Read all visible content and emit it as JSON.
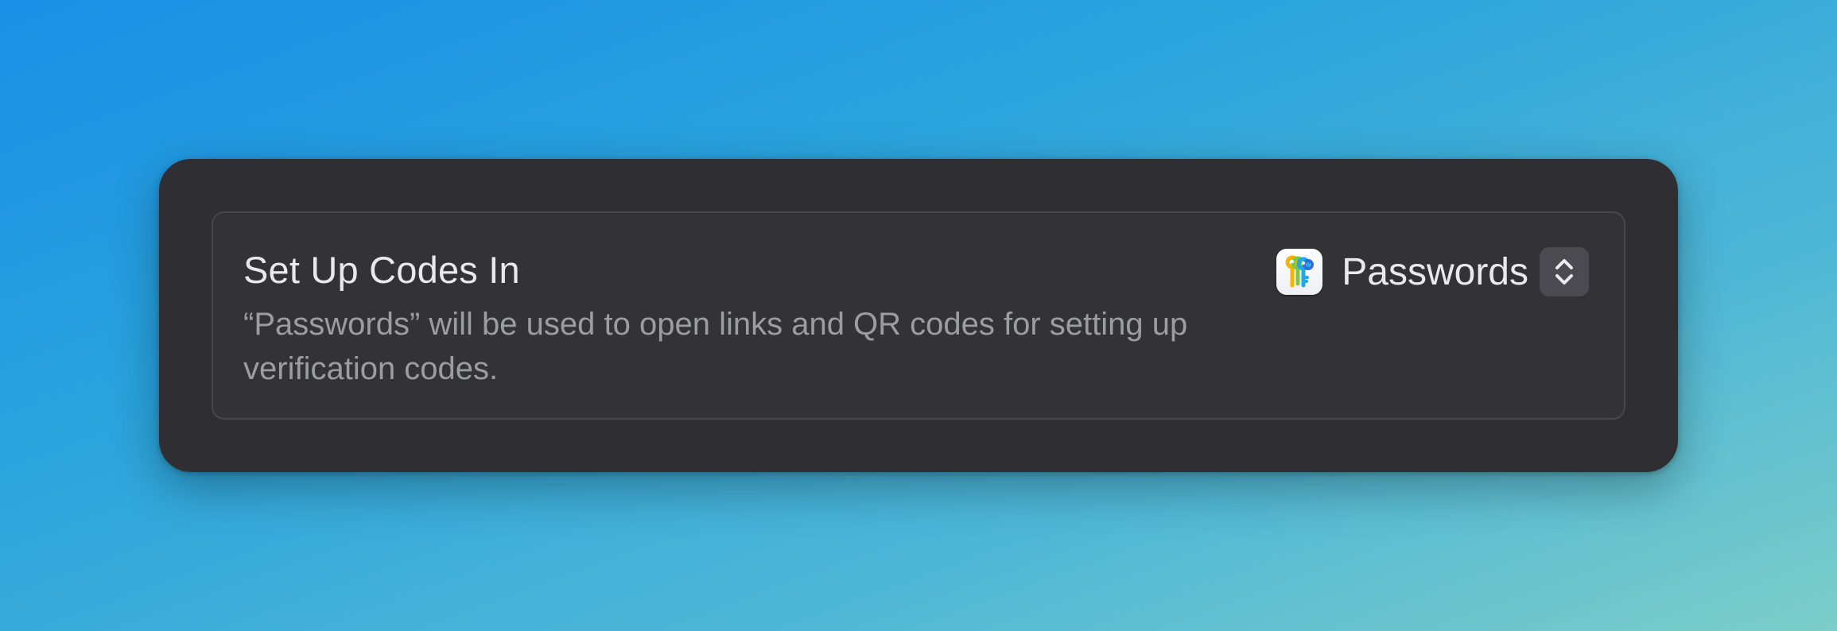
{
  "setting": {
    "title": "Set Up Codes In",
    "description": "“Passwords” will be used to open links and QR codes for setting up verification codes."
  },
  "picker": {
    "selected_app": "Passwords",
    "app_icon": "passwords-app-icon",
    "control_icon": "chevron-up-down-icon"
  },
  "colors": {
    "panel_background": "#2f2f33",
    "row_border": "#47474c",
    "title_text": "#e9e9ec",
    "description_text": "#9c9ca3"
  }
}
